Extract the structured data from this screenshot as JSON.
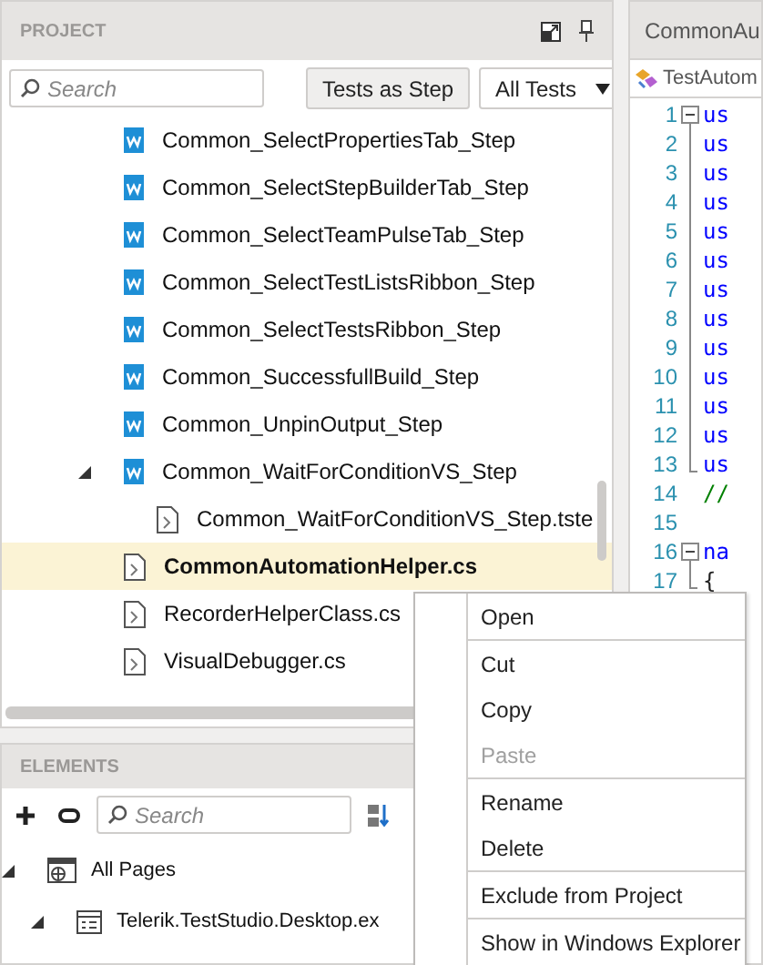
{
  "project": {
    "title": "PROJECT",
    "search": {
      "placeholder": "Search"
    },
    "tests_as_step_button": "Tests as Step",
    "filter": {
      "value": "All Tests"
    },
    "tree": [
      {
        "label": "Common_SelectPropertiesTab_Step",
        "kind": "test",
        "selected": false
      },
      {
        "label": "Common_SelectStepBuilderTab_Step",
        "kind": "test",
        "selected": false
      },
      {
        "label": "Common_SelectTeamPulseTab_Step",
        "kind": "test",
        "selected": false
      },
      {
        "label": "Common_SelectTestListsRibbon_Step",
        "kind": "test",
        "selected": false
      },
      {
        "label": "Common_SelectTestsRibbon_Step",
        "kind": "test",
        "selected": false
      },
      {
        "label": "Common_SuccessfullBuild_Step",
        "kind": "test",
        "selected": false
      },
      {
        "label": "Common_UnpinOutput_Step",
        "kind": "test",
        "selected": false
      },
      {
        "label": "Common_WaitForConditionVS_Step",
        "kind": "test",
        "selected": false,
        "expanded": true,
        "children": [
          {
            "label": "Common_WaitForConditionVS_Step.tste",
            "kind": "file",
            "selected": false
          }
        ]
      },
      {
        "label": "CommonAutomationHelper.cs",
        "kind": "file",
        "selected": true
      },
      {
        "label": "RecorderHelperClass.cs",
        "kind": "file",
        "selected": false
      },
      {
        "label": "VisualDebugger.cs",
        "kind": "file",
        "selected": false
      }
    ]
  },
  "elements": {
    "title": "ELEMENTS",
    "search": {
      "placeholder": "Search"
    },
    "tree": [
      {
        "label": "All Pages",
        "kind": "pages",
        "expanded": true,
        "children": [
          {
            "label": "Telerik.TestStudio.Desktop.ex",
            "kind": "page",
            "expanded": true
          }
        ]
      }
    ]
  },
  "editor": {
    "tab": "CommonAu",
    "breadcrumb": "TestAutom",
    "lines": [
      {
        "number": "1",
        "code": "us",
        "kind": "keyword",
        "fold_start": true,
        "in_fold": false
      },
      {
        "number": "2",
        "code": "us",
        "kind": "keyword",
        "fold_start": false,
        "in_fold": true
      },
      {
        "number": "3",
        "code": "us",
        "kind": "keyword",
        "fold_start": false,
        "in_fold": true
      },
      {
        "number": "4",
        "code": "us",
        "kind": "keyword",
        "fold_start": false,
        "in_fold": true
      },
      {
        "number": "5",
        "code": "us",
        "kind": "keyword",
        "fold_start": false,
        "in_fold": true
      },
      {
        "number": "6",
        "code": "us",
        "kind": "keyword",
        "fold_start": false,
        "in_fold": true
      },
      {
        "number": "7",
        "code": "us",
        "kind": "keyword",
        "fold_start": false,
        "in_fold": true
      },
      {
        "number": "8",
        "code": "us",
        "kind": "keyword",
        "fold_start": false,
        "in_fold": true
      },
      {
        "number": "9",
        "code": "us",
        "kind": "keyword",
        "fold_start": false,
        "in_fold": true
      },
      {
        "number": "10",
        "code": "us",
        "kind": "keyword",
        "fold_start": false,
        "in_fold": true
      },
      {
        "number": "11",
        "code": "us",
        "kind": "keyword",
        "fold_start": false,
        "in_fold": true
      },
      {
        "number": "12",
        "code": "us",
        "kind": "keyword",
        "fold_start": false,
        "in_fold": true
      },
      {
        "number": "13",
        "code": "us",
        "kind": "keyword",
        "fold_start": false,
        "in_fold": true
      },
      {
        "number": "14",
        "code": "//",
        "kind": "comment",
        "fold_start": false,
        "in_fold": false
      },
      {
        "number": "15",
        "fold_start": false,
        "in_fold": false
      },
      {
        "number": "16",
        "code": "na",
        "kind": "keyword",
        "fold_start": true,
        "in_fold": false
      },
      {
        "number": "17",
        "code": "{",
        "kind": "plain",
        "fold_start": false,
        "in_fold": true
      }
    ]
  },
  "context_menu": [
    {
      "label": "Open",
      "disabled": false,
      "separator_after": true
    },
    {
      "label": "Cut",
      "disabled": false,
      "separator_after": false
    },
    {
      "label": "Copy",
      "disabled": false,
      "separator_after": false
    },
    {
      "label": "Paste",
      "disabled": true,
      "separator_after": true
    },
    {
      "label": "Rename",
      "disabled": false,
      "separator_after": false
    },
    {
      "label": "Delete",
      "disabled": false,
      "separator_after": true
    },
    {
      "label": "Exclude from Project",
      "disabled": false,
      "separator_after": true
    },
    {
      "label": "Show in Windows Explorer",
      "disabled": false,
      "separator_after": false
    }
  ]
}
